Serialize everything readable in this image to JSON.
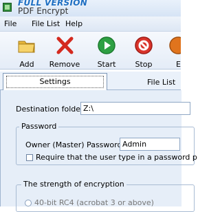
{
  "window": {
    "banner": "FULL VERSION",
    "title": "PDF Encrypt"
  },
  "menu": {
    "items": [
      {
        "label": "File"
      },
      {
        "label": "File List"
      },
      {
        "label": "Help"
      }
    ]
  },
  "toolbar": {
    "add_label": "Add",
    "remove_label": "Remove",
    "start_label": "Start",
    "stop_label": "Stop",
    "partial_label": "E"
  },
  "tabs": {
    "settings": "Settings",
    "file_list": "File List"
  },
  "settings": {
    "destination_label": "Destination folder:",
    "destination_value": "Z:\\",
    "password_group": "Password",
    "owner_password_label": "Owner (Master) Password:",
    "owner_password_value": "Admin",
    "require_password_label": "Require that the user type in a password p",
    "strength_group": "The strength of encryption",
    "rc4_40_label": "40-bit RC4 (acrobat 3 or above)"
  },
  "colors": {
    "accent": "#1e6fc2",
    "start_green": "#2ea043",
    "stop_red": "#d9342b"
  }
}
